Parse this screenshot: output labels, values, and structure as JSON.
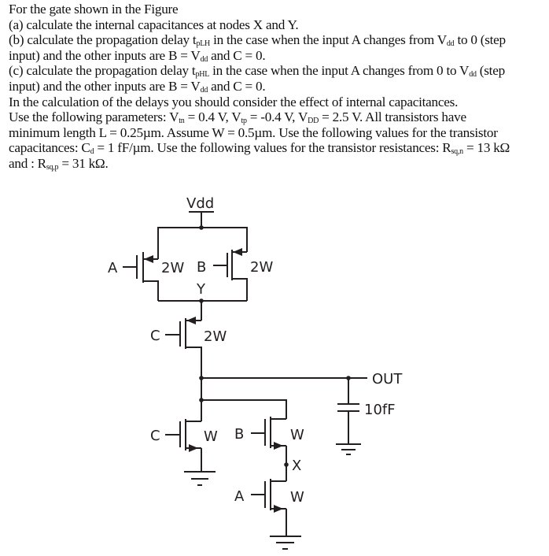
{
  "problem": {
    "lines": [
      [
        {
          "t": "For the gate shown in the Figure"
        }
      ],
      [
        {
          "t": "(a) calculate the internal capacitances at nodes X and Y."
        }
      ],
      [
        {
          "t": "(b) calculate the propagation delay t"
        },
        {
          "sub": "pLH"
        },
        {
          "t": " in the case when the input A changes from V"
        },
        {
          "sub": "dd"
        },
        {
          "t": " to 0 (step"
        }
      ],
      [
        {
          "t": "input) and the other inputs are B = V"
        },
        {
          "sub": "dd"
        },
        {
          "t": " and C = 0."
        }
      ],
      [
        {
          "t": "(c) calculate the propagation delay t"
        },
        {
          "sub": "pHL"
        },
        {
          "t": " in the case when the input A changes from 0 to V"
        },
        {
          "sub": "dd"
        },
        {
          "t": " (step"
        }
      ],
      [
        {
          "t": "input) and the other inputs are B = V"
        },
        {
          "sub": "dd"
        },
        {
          "t": " and C = 0."
        }
      ],
      [
        {
          "t": "In the calculation of the delays you should consider the effect of internal capacitances."
        }
      ],
      [
        {
          "t": "Use the following parameters: V"
        },
        {
          "sub": "tn"
        },
        {
          "t": " = 0.4 V, V"
        },
        {
          "sub": "tp"
        },
        {
          "t": " = -0.4 V, V"
        },
        {
          "sub": "DD"
        },
        {
          "t": " = 2.5 V. All transistors have"
        }
      ],
      [
        {
          "t": "minimum length L = 0.25µm. Assume W = 0.5µm. Use the following values for the transistor"
        }
      ],
      [
        {
          "t": "capacitances: C"
        },
        {
          "sub": "d"
        },
        {
          "t": " = 1 fF/µm. Use the following values for the transistor resistances: R"
        },
        {
          "sub": "sq,n"
        },
        {
          "t": " = 13 kΩ"
        }
      ],
      [
        {
          "t": "and : R"
        },
        {
          "sub": "sq,p"
        },
        {
          "t": " = 31 kΩ."
        }
      ]
    ]
  },
  "figure": {
    "supply_label": "Vdd",
    "node_y_label": "Y",
    "node_x_label": "X",
    "output_label": "OUT",
    "load_cap_label": "10fF",
    "pmos_a": {
      "gate": "A",
      "size": "2W"
    },
    "pmos_b": {
      "gate": "B",
      "size": "2W"
    },
    "pmos_c": {
      "gate": "C",
      "size": "2W"
    },
    "nmos_c": {
      "gate": "C",
      "size": "W"
    },
    "nmos_b": {
      "gate": "B",
      "size": "W"
    },
    "nmos_a": {
      "gate": "A",
      "size": "W"
    }
  }
}
